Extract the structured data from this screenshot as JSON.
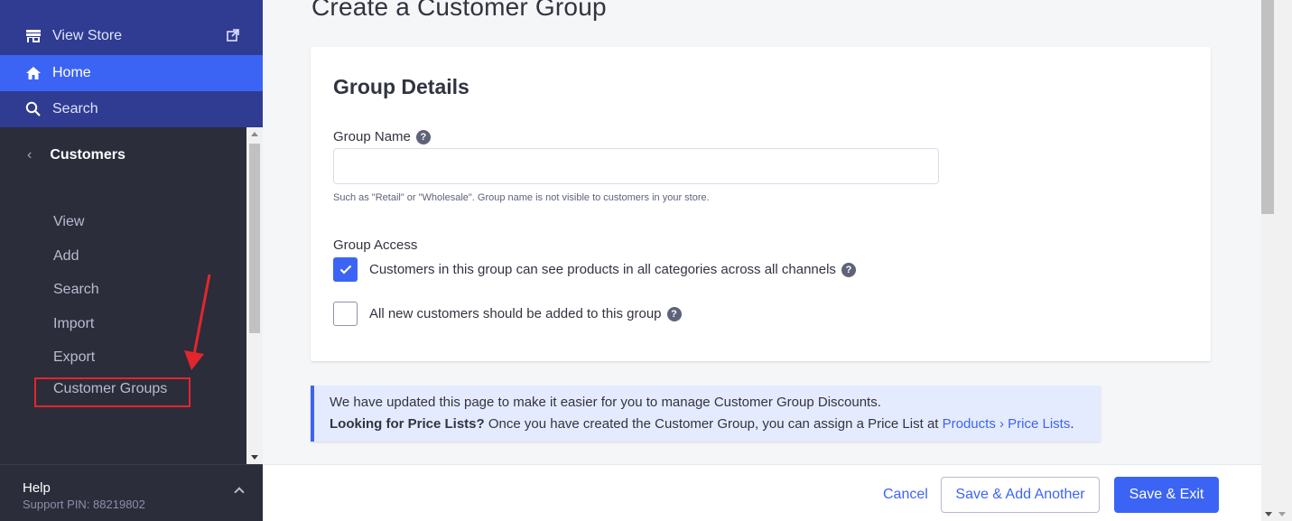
{
  "sidebar": {
    "view_store": "View Store",
    "home": "Home",
    "search": "Search",
    "section_title": "Customers",
    "items": [
      {
        "label": "View"
      },
      {
        "label": "Add"
      },
      {
        "label": "Search"
      },
      {
        "label": "Import"
      },
      {
        "label": "Export"
      },
      {
        "label": "Customer Groups"
      }
    ],
    "help_title": "Help",
    "support_pin": "Support PIN: 88219802"
  },
  "main": {
    "page_title": "Create a Customer Group",
    "card_title": "Group Details",
    "group_name_label": "Group Name",
    "group_name_value": "",
    "group_name_hint": "Such as \"Retail\" or \"Wholesale\". Group name is not visible to customers in your store.",
    "group_access_label": "Group Access",
    "checkbox_all_categories": "Customers in this group can see products in all categories across all channels",
    "checkbox_all_categories_checked": true,
    "checkbox_new_customers": "All new customers should be added to this group",
    "checkbox_new_customers_checked": false
  },
  "notice": {
    "line1": "We have updated this page to make it easier for you to manage Customer Group Discounts.",
    "line2_bold": "Looking for Price Lists?",
    "line2_text": " Once you have created the Customer Group, you can assign a Price List at ",
    "line2_link": "Products › Price Lists",
    "line2_end": "."
  },
  "footer": {
    "cancel": "Cancel",
    "save_add_another": "Save & Add Another",
    "save_exit": "Save & Exit"
  },
  "colors": {
    "accent": "#3c64f4",
    "sidebar_top": "#2f3c91",
    "sidebar_dark": "#2b2d3b",
    "annotation_red": "#e3262b"
  }
}
